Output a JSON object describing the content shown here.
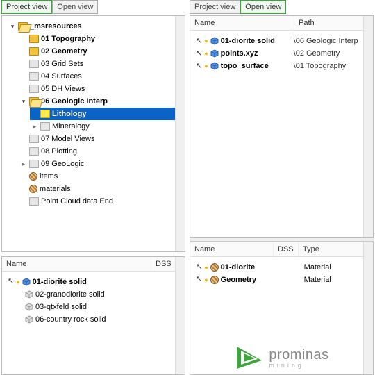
{
  "left": {
    "tabs": {
      "project": "Project view",
      "open": "Open view"
    },
    "tree": {
      "root": "_msresources",
      "n01": "01 Topography",
      "n02": "02 Geometry",
      "n03": "03 Grid Sets",
      "n04": "04 Surfaces",
      "n05": "05 DH Views",
      "n06": "06 Geologic Interp",
      "n06a": "Lithology",
      "n06b": "Mineralogy",
      "n07": "07 Model Views",
      "n08": "08 Plotting",
      "n09": "09 GeoLogic",
      "items": "items",
      "materials": "materials",
      "pcloud": "Point Cloud data End"
    },
    "detail": {
      "head_name": "Name",
      "head_dss": "DSS",
      "r1": "01-diorite solid",
      "r2": "02-granodiorite solid",
      "r3": "03-qtxfeld solid",
      "r4": "06-country rock solid"
    }
  },
  "right": {
    "tabs": {
      "project": "Project view",
      "open": "Open view"
    },
    "top": {
      "head_name": "Name",
      "head_path": "Path",
      "r1_name": "01-diorite solid",
      "r1_path": "\\06 Geologic Interp",
      "r2_name": "points.xyz",
      "r2_path": "\\02 Geometry",
      "r3_name": "topo_surface",
      "r3_path": "\\01 Topography"
    },
    "bottom": {
      "head_name": "Name",
      "head_dss": "DSS",
      "head_type": "Type",
      "r1_name": "01-diorite",
      "r1_type": "Material",
      "r2_name": "Geometry",
      "r2_type": "Material"
    },
    "logo_main": "prominas",
    "logo_sub": "mining"
  }
}
